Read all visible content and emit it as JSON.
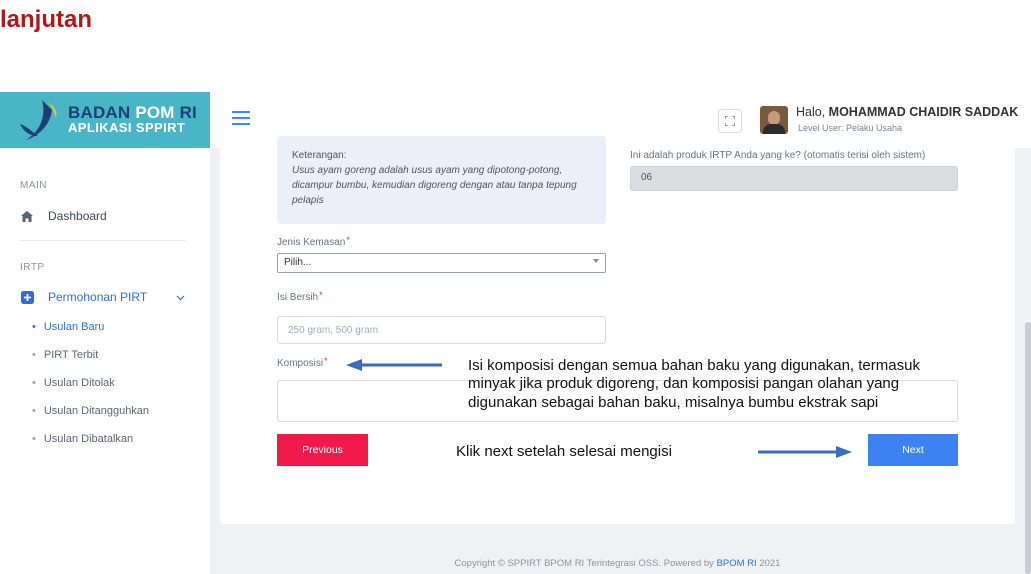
{
  "slide_title": "lanjutan",
  "brand": {
    "line1_a": "BADAN ",
    "line1_b": "POM",
    "line1_c": " RI",
    "line2": "APLIKASI SPPIRT"
  },
  "header": {
    "greeting_prefix": "Halo, ",
    "user_name": "MOHAMMAD CHAIDIR SADDAK",
    "level": "Level User: Pelaku Usaha"
  },
  "sidebar": {
    "section_main": "MAIN",
    "dashboard": "Dashboard",
    "section_irtp": "IRTP",
    "group": "Permohonan PIRT",
    "items": [
      {
        "label": "Usulan Baru",
        "active": true
      },
      {
        "label": "PIRT Terbit"
      },
      {
        "label": "Usulan Ditolak"
      },
      {
        "label": "Usulan Ditangguhkan"
      },
      {
        "label": "Usulan Dibatalkan"
      }
    ]
  },
  "form": {
    "note_title": "Keterangan:",
    "note_body": "Usus ayam goreng adalah usus ayam yang dipotong-potong, dicampur bumbu, kemudian digoreng dengan atau tanpa tepung pelapis",
    "produk_ke_label": "Ini adalah produk IRTP Anda yang ke? (otomatis terisi oleh sistem)",
    "produk_ke_value": "06",
    "jenis_kemasan_label": "Jenis Kemasan",
    "jenis_kemasan_value": "Pilih...",
    "isi_bersih_label": "Isi Bersih",
    "isi_bersih_placeholder": "250 gram, 500 gram",
    "komposisi_label": "Komposisi",
    "required_mark": "*",
    "previous_label": "Previous",
    "next_label": "Next"
  },
  "callouts": {
    "komposisi_l1": "Isi komposisi dengan semua bahan baku yang digunakan, termasuk",
    "komposisi_l2": "minyak jika produk digoreng, dan komposisi pangan olahan yang",
    "komposisi_l3": "digunakan sebagai bahan baku, misalnya bumbu ekstrak sapi",
    "next": "Klik next setelah selesai mengisi"
  },
  "footer": {
    "text": "Copyright © SPPIRT BPOM RI Terintegrasi OSS. Powered by ",
    "link": "BPOM RI",
    "year": " 2021"
  },
  "colors": {
    "brand": "#48b6c6",
    "title_red": "#b01919",
    "primary": "#3d82f2",
    "danger": "#f1194a",
    "arrow": "#3a6cc4"
  }
}
